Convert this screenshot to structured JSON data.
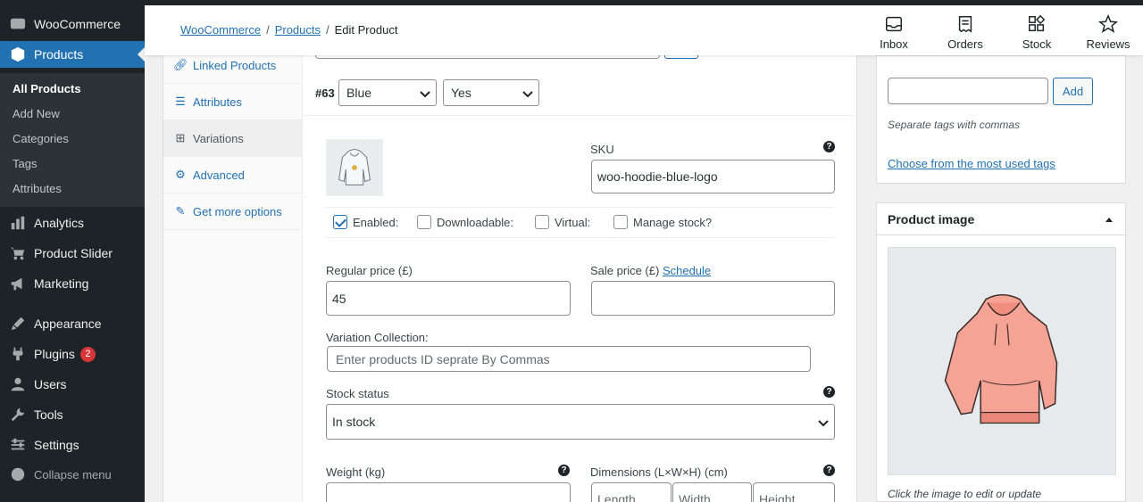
{
  "admin_menu": {
    "woocommerce": "WooCommerce",
    "products": "Products",
    "submenu": [
      "All Products",
      "Add New",
      "Categories",
      "Tags",
      "Attributes"
    ],
    "items": [
      "Analytics",
      "Product Slider",
      "Marketing",
      "Appearance",
      "Plugins",
      "Users",
      "Tools",
      "Settings"
    ],
    "plugins_badge": "2",
    "collapse": "Collapse menu"
  },
  "header": {
    "breadcrumb": [
      "WooCommerce",
      "Products",
      "Edit Product"
    ],
    "sep": "/",
    "actions": [
      "Inbox",
      "Orders",
      "Stock",
      "Reviews"
    ]
  },
  "tabs": [
    "Linked Products",
    "Attributes",
    "Variations",
    "Advanced",
    "Get more options"
  ],
  "variation": {
    "id": "#63",
    "attr1": "Blue",
    "attr2": "Yes",
    "sku_label": "SKU",
    "sku": "woo-hoodie-blue-logo",
    "checks": [
      "Enabled:",
      "Downloadable:",
      "Virtual:",
      "Manage stock?"
    ],
    "checks_state": [
      true,
      false,
      false,
      false
    ],
    "regular_price_label": "Regular price (£)",
    "regular_price": "45",
    "sale_price_label": "Sale price (£)",
    "schedule": "Schedule",
    "collection_label": "Variation Collection:",
    "collection_placeholder": "Enter products ID seprate By Commas",
    "stock_status_label": "Stock status",
    "stock_status": "In stock",
    "weight_label": "Weight (kg)",
    "dimensions_label": "Dimensions (L×W×H) (cm)",
    "dims": [
      "Length",
      "Width",
      "Height"
    ],
    "help": "?"
  },
  "tags_box": {
    "add": "Add",
    "hint": "Separate tags with commas",
    "choose": "Choose from the most used tags"
  },
  "image_box": {
    "title": "Product image",
    "hint": "Click the image to edit or update"
  },
  "colors": {
    "accent": "#2271b1",
    "menu_bg": "#1d2327",
    "badge": "#d63638"
  }
}
